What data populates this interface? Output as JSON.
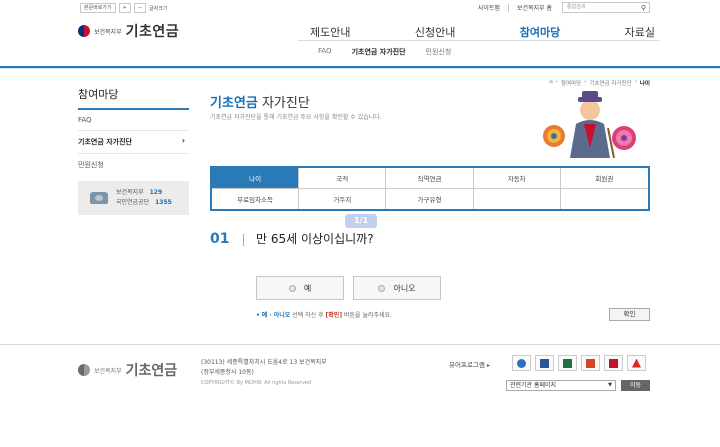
{
  "util": {
    "shortcut": "본문바로가기",
    "zoom_in": "+",
    "zoom_out": "−",
    "font_size": "글자크기",
    "sitemap": "사이트맵",
    "ministry_home": "보건복지부 홈",
    "search_placeholder": "통합검색"
  },
  "logo": {
    "ministry": "보건복지부",
    "title": "기초연금"
  },
  "gnb": [
    "제도안내",
    "신청안내",
    "참여마당",
    "자료실"
  ],
  "lnb": [
    "FAQ",
    "기초연금 자가진단",
    "민원신청"
  ],
  "sidebar": {
    "title": "참여마당",
    "items": [
      {
        "label": "FAQ"
      },
      {
        "label": "기초연금 자가진단",
        "arrow": "›"
      },
      {
        "label": "민원신청"
      }
    ],
    "call": [
      {
        "name": "보건복지부",
        "number": "129"
      },
      {
        "name": "국민연금공단",
        "number": "1355"
      }
    ]
  },
  "breadcrumb": [
    "참여마당",
    "기초연금 자가진단",
    "나이"
  ],
  "title": {
    "blue": "기초연금",
    "rest": " 자가진단"
  },
  "description": "기초연금 자가진단을 통해 기초연금 주요 사항을 확인할 수 있습니다.",
  "tabs": [
    "나이",
    "국적",
    "직역연금",
    "자동차",
    "회원권",
    "무료임차소득",
    "거주지",
    "가구유형",
    ""
  ],
  "stamp": "1/1",
  "question": {
    "num": "01",
    "text": "만 65세 이상이십니까?"
  },
  "answers": {
    "yes": "예",
    "no": "아니오"
  },
  "hint": {
    "bullet": "•",
    "lead": "예 · 아니오",
    "mid": " 선택 하신 후 ",
    "confirm": "[확인]",
    "tail": " 버튼을 눌러주세요."
  },
  "confirm_button": "확인",
  "footer": {
    "ministry": "보건복지부",
    "title": "기초연금",
    "addr1": "(30113) 세종특별자치시 도움4로 13 보건복지부",
    "addr2": "(정부세종청사 10동)",
    "copyright": "COPYRIGHT© By MOHW. All rights Reserved",
    "viewer": "뷰어프로그램",
    "viewer_tri": "▸",
    "viewer_icons": [
      {
        "name": "hwp",
        "color": "#2f6fc0"
      },
      {
        "name": "word",
        "color": "#2b5797"
      },
      {
        "name": "excel",
        "color": "#1e7145"
      },
      {
        "name": "powerpoint",
        "color": "#d24726"
      },
      {
        "name": "pdf-reader",
        "color": "#c8102e"
      },
      {
        "name": "acrobat",
        "color": "#e0251b"
      }
    ],
    "related": "관련기관 홈페이지",
    "go": "이동"
  }
}
